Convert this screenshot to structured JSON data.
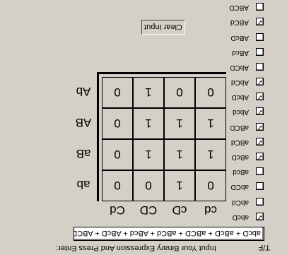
{
  "truth_table": {
    "header": "T/F",
    "rows": [
      {
        "label": "abcd",
        "checked": false
      },
      {
        "label": "abcD",
        "checked": true
      },
      {
        "label": "abCd",
        "checked": false
      },
      {
        "label": "abCD",
        "checked": false
      },
      {
        "label": "aBcd",
        "checked": false
      },
      {
        "label": "aBcD",
        "checked": true
      },
      {
        "label": "aBCd",
        "checked": true
      },
      {
        "label": "aBCD",
        "checked": true
      },
      {
        "label": "Abcd",
        "checked": true
      },
      {
        "label": "AbcD",
        "checked": true
      },
      {
        "label": "AbCd",
        "checked": true
      },
      {
        "label": "AbCD",
        "checked": false
      },
      {
        "label": "ABcd",
        "checked": false
      },
      {
        "label": "ABcD",
        "checked": false
      },
      {
        "label": "ABCd",
        "checked": true
      },
      {
        "label": "ABCD",
        "checked": false
      }
    ]
  },
  "expression": {
    "instruction": "Input Your Binary Expression And Press Enter:",
    "value": "abcD + aBcD + aBCD + aBCd + ABcd + ABcD + ABCD"
  },
  "kmap": {
    "col_headers": [
      "cd",
      "cD",
      "CD",
      "Cd"
    ],
    "row_headers": [
      "ab",
      "aB",
      "AB",
      "Ab"
    ],
    "cells": [
      [
        "0",
        "1",
        "0",
        "0"
      ],
      [
        "1",
        "1",
        "1",
        "0"
      ],
      [
        "1",
        "1",
        "1",
        "0"
      ],
      [
        "0",
        "0",
        "1",
        "0"
      ]
    ]
  },
  "clear_button": {
    "label": "Clear Input"
  }
}
